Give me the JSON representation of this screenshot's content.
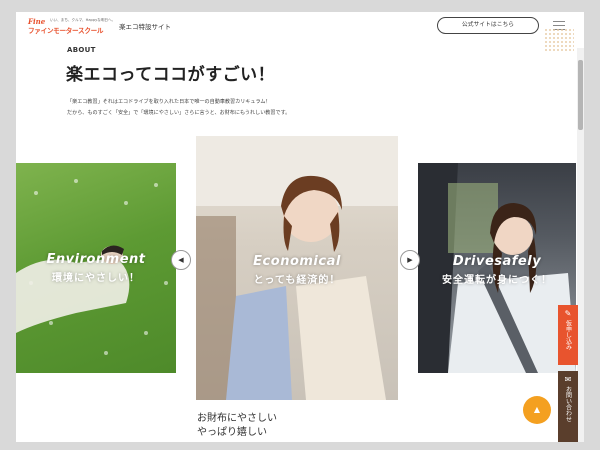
{
  "header": {
    "logo_top": "Fine",
    "logo_tagline": "いい、まち、クルマ、Happyな明日へ。",
    "logo_main": "ファインモータースクール",
    "site_name": "楽エコ特設サイト",
    "official_button": "公式サイトはこちら",
    "menu_icon": "hamburger-icon"
  },
  "about": {
    "label": "ABOUT",
    "title": "楽エコってココがすごい！",
    "desc_line1": "「楽エコ教習」それはエコドライブを取り入れた日本で唯一の自動車教習カリキュラム！",
    "desc_line2": "だから、ものすごく「安全」で「環境にやさしい」さらに言うと、お財布にもうれしい教習です。"
  },
  "slides": [
    {
      "en": "Environment",
      "ja": "環境にやさしい！"
    },
    {
      "en": "Economical",
      "ja": "とっても経済的！"
    },
    {
      "en": "Drivesafely",
      "ja": "安全運転が身につく！"
    }
  ],
  "arrows": {
    "prev": "◀",
    "next": "▶"
  },
  "below_text": {
    "line1": "お財布にやさしい",
    "line2": "やっぱり嬉しい"
  },
  "side_tabs": {
    "trial_label": "仮申し込み",
    "trial_icon": "edit-icon",
    "contact_label": "お問い合わせ",
    "contact_icon": "mail-icon"
  },
  "page_top": {
    "icon": "▲"
  },
  "colors": {
    "brand": "#e8502c",
    "trial_tab": "#e8542e",
    "contact_tab": "#5a3e2c",
    "top_button": "#f4a020"
  }
}
